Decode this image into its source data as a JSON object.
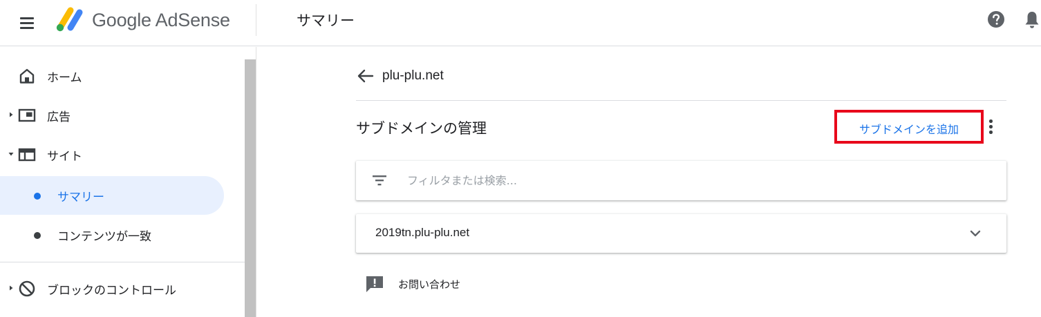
{
  "app": {
    "product_name": "Google AdSense",
    "page_title": "サマリー"
  },
  "sidebar": {
    "items": [
      {
        "label": "ホーム",
        "icon": "home-icon"
      },
      {
        "label": "広告",
        "icon": "ads-icon"
      },
      {
        "label": "サイト",
        "icon": "sites-icon"
      },
      {
        "label": "サマリー",
        "active": true
      },
      {
        "label": "コンテンツが一致"
      },
      {
        "label": "ブロックのコントロール",
        "icon": "block-icon"
      }
    ]
  },
  "main": {
    "site_name": "plu-plu.net",
    "section_title": "サブドメインの管理",
    "add_subdomain_label": "サブドメインを追加",
    "filter": {
      "placeholder": "フィルタまたは検索..."
    },
    "subdomains": [
      "2019tn.plu-plu.net"
    ],
    "feedback_label": "お問い合わせ"
  },
  "colors": {
    "accent": "#1a73e8",
    "highlight_border": "#e8071b",
    "active_bg": "#e8f0fe"
  }
}
